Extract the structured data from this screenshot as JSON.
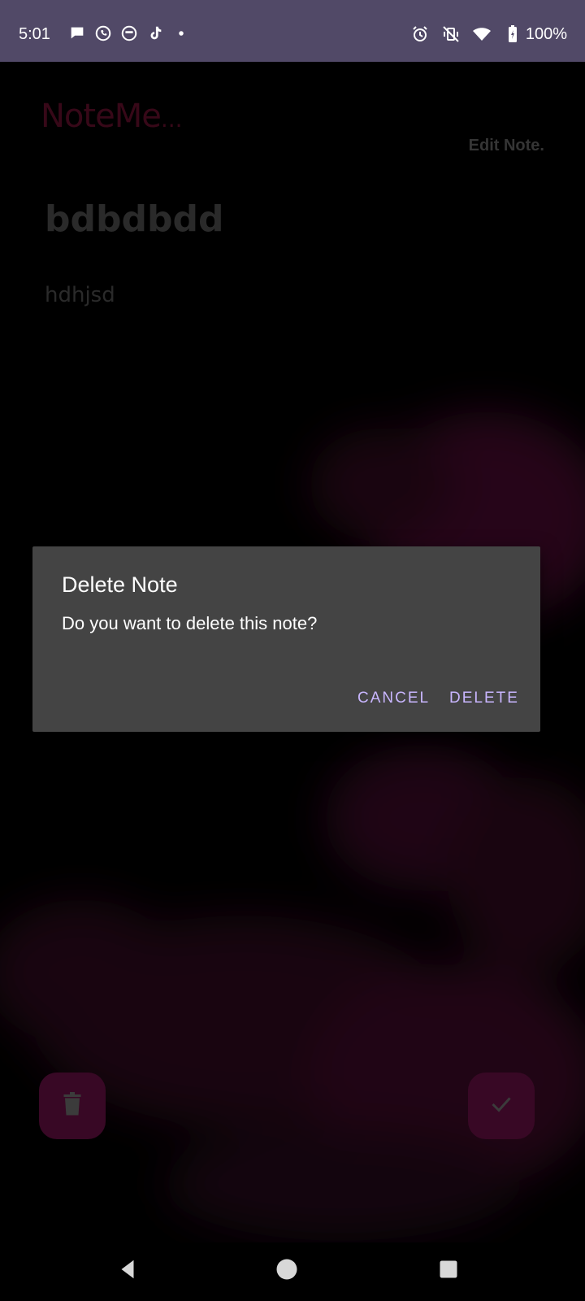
{
  "status_bar": {
    "time": "5:01",
    "battery_percent": "100%",
    "notification_icons": [
      "chat-bubble-icon",
      "whatsapp-icon",
      "bag-app-icon",
      "tiktok-icon",
      "dot-icon"
    ],
    "system_icons": [
      "alarm-icon",
      "vibrate-off-icon",
      "wifi-icon",
      "battery-icon"
    ],
    "background_color": "#514967"
  },
  "app": {
    "logo_text": "NoteMe",
    "logo_suffix": "...",
    "header_title": "Edit Note.",
    "note_title": "bdbdbdd",
    "note_body": "hdhjsd",
    "accent_color": "#70104a"
  },
  "fabs": {
    "delete_icon": "trash-icon",
    "save_icon": "check-icon"
  },
  "dialog": {
    "title": "Delete Note",
    "message": "Do you want to delete this note?",
    "cancel_label": "CANCEL",
    "delete_label": "DELETE",
    "button_color": "#c9b6ff"
  },
  "nav_bar": {
    "buttons": [
      "back-icon",
      "home-icon",
      "recents-icon"
    ]
  }
}
